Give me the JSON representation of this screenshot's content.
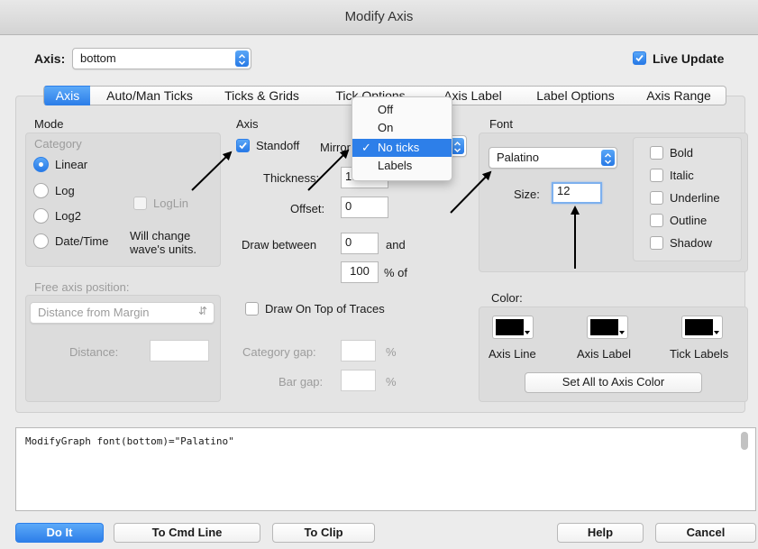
{
  "window": {
    "title": "Modify Axis"
  },
  "axis_select": {
    "label": "Axis:",
    "value": "bottom"
  },
  "live_update": {
    "label": "Live Update",
    "checked": true
  },
  "tabs": [
    {
      "label": "Axis",
      "active": true
    },
    {
      "label": "Auto/Man Ticks"
    },
    {
      "label": "Ticks & Grids"
    },
    {
      "label": "Tick Options"
    },
    {
      "label": "Axis Label"
    },
    {
      "label": "Label Options"
    },
    {
      "label": "Axis Range"
    }
  ],
  "mode": {
    "title": "Mode",
    "category": "Category",
    "options": [
      "Linear",
      "Log",
      "Log2",
      "Date/Time"
    ],
    "selected": "Linear",
    "loglin": "LogLin",
    "note": "Will change wave's units."
  },
  "free_axis": {
    "title": "Free axis position:",
    "select": "Distance from Margin",
    "distance_label": "Distance:"
  },
  "axis": {
    "title": "Axis",
    "standoff": "Standoff",
    "mirror_label": "Mirror",
    "thickness_label": "Thickness:",
    "thickness_value": "1.00",
    "offset_label": "Offset:",
    "offset_value": "0",
    "draw_between_label": "Draw between",
    "draw_between_from": "0",
    "and_label": "and",
    "draw_between_to": "100",
    "percent_of": "% of",
    "draw_on_top": "Draw On Top of Traces",
    "category_gap": "Category gap:",
    "bar_gap": "Bar gap:",
    "percent": "%"
  },
  "mirror_menu": {
    "items": [
      "Off",
      "On",
      "No ticks",
      "Labels"
    ],
    "selected": "No ticks"
  },
  "font": {
    "title": "Font",
    "family": "Palatino",
    "size_label": "Size:",
    "size_value": "12",
    "styles": [
      "Bold",
      "Italic",
      "Underline",
      "Outline",
      "Shadow"
    ]
  },
  "color": {
    "title": "Color:",
    "swatches": [
      "Axis Line",
      "Axis Label",
      "Tick Labels"
    ],
    "swatch_color": "#000000",
    "set_all": "Set All to Axis Color"
  },
  "command": {
    "text": "ModifyGraph font(bottom)=\"Palatino\""
  },
  "buttons": {
    "do_it": "Do It",
    "to_cmd": "To Cmd Line",
    "to_clip": "To Clip",
    "help": "Help",
    "cancel": "Cancel"
  },
  "accent": "#2d7fe9"
}
